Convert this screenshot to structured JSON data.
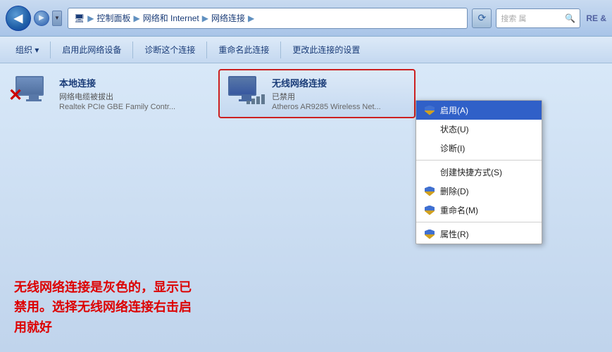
{
  "titlebar": {
    "breadcrumb": [
      "控制面板",
      "网络和 Internet",
      "网络连接"
    ],
    "search_placeholder": "搜索 属",
    "refresh_symbol": "⟳"
  },
  "toolbar": {
    "items": [
      {
        "label": "组织 ▾"
      },
      {
        "label": "启用此网络设备"
      },
      {
        "label": "诊断这个连接"
      },
      {
        "label": "重命名此连接"
      },
      {
        "label": "更改此连接的设置"
      }
    ]
  },
  "connections": {
    "local": {
      "name": "本地连接",
      "status": "网络电缆被拔出",
      "adapter": "Realtek PCIe GBE Family Contr..."
    },
    "wireless": {
      "name": "无线网络连接",
      "status": "已禁用",
      "adapter": "Atheros AR9285 Wireless Net..."
    }
  },
  "context_menu": {
    "items": [
      {
        "label": "启用(A)",
        "highlighted": true,
        "has_shield": true
      },
      {
        "label": "状态(U)",
        "highlighted": false,
        "has_shield": false
      },
      {
        "label": "诊断(I)",
        "highlighted": false,
        "has_shield": false
      },
      {
        "label": "divider"
      },
      {
        "label": "创建快捷方式(S)",
        "highlighted": false,
        "has_shield": false
      },
      {
        "label": "删除(D)",
        "highlighted": false,
        "has_shield": true
      },
      {
        "label": "重命名(M)",
        "highlighted": false,
        "has_shield": true
      },
      {
        "label": "属性(R)",
        "highlighted": false,
        "has_shield": true
      }
    ]
  },
  "instruction": {
    "text": "无线网络连接是灰色的，显示已禁用。选择无线网络连接右击启用就好"
  },
  "corner_text": "RE &"
}
